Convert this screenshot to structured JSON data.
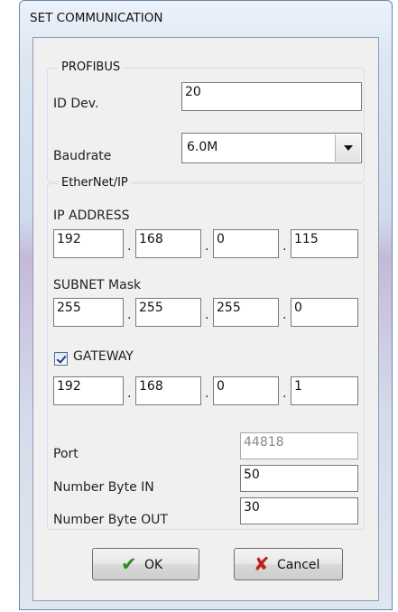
{
  "window": {
    "title": "SET COMMUNICATION"
  },
  "profibus": {
    "legend": "PROFIBUS",
    "id_label": "ID Dev.",
    "id_value": "20",
    "baud_label": "Baudrate",
    "baud_value": "6.0M"
  },
  "ethernet": {
    "legend": "EtherNet/IP",
    "ip_label": "IP ADDRESS",
    "ip": [
      "192",
      "168",
      "0",
      "115"
    ],
    "mask_label": "SUBNET Mask",
    "mask": [
      "255",
      "255",
      "255",
      "0"
    ],
    "gateway_label": "GATEWAY",
    "gateway_checked": true,
    "gateway": [
      "192",
      "168",
      "0",
      "1"
    ],
    "separator": ".",
    "port_label": "Port",
    "port_value": "44818",
    "byte_in_label": "Number Byte IN",
    "byte_in_value": "50",
    "byte_out_label": "Number Byte OUT",
    "byte_out_value": "30"
  },
  "buttons": {
    "ok_label": "OK",
    "ok_icon": "checkmark-icon",
    "cancel_label": "Cancel",
    "cancel_icon": "x-icon"
  },
  "colors": {
    "ok_icon": "#2e8b1e",
    "cancel_icon": "#c0221a"
  }
}
